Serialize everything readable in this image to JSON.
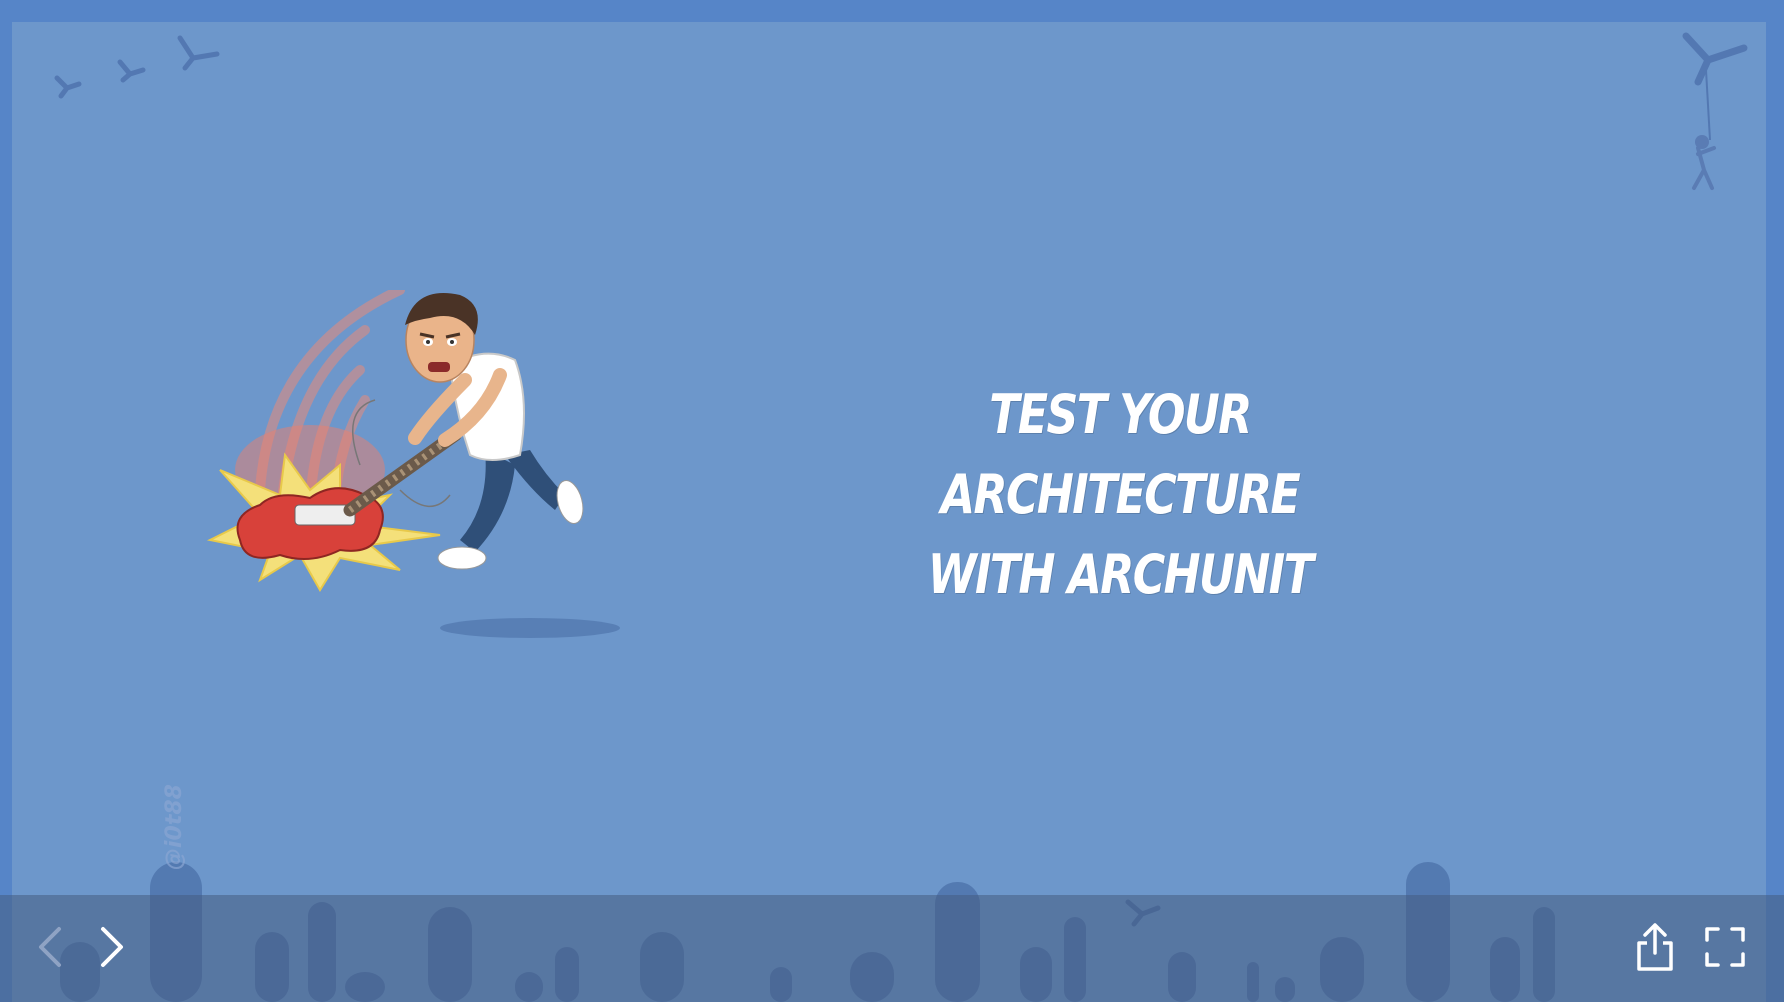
{
  "slide": {
    "title_line1": "TEST YOUR ARCHITECTURE",
    "title_line2": "WITH ARCHUNIT",
    "watermark": "@i0t88",
    "background_color": "#6d97cb",
    "frame_color": "#5685c8"
  },
  "illustration": {
    "description_icon": "bitmoji-smashing-guitar-icon"
  },
  "controls": {
    "prev_icon": "chevron-left-icon",
    "next_icon": "chevron-right-icon",
    "share_icon": "share-icon",
    "fullscreen_icon": "fullscreen-icon"
  }
}
